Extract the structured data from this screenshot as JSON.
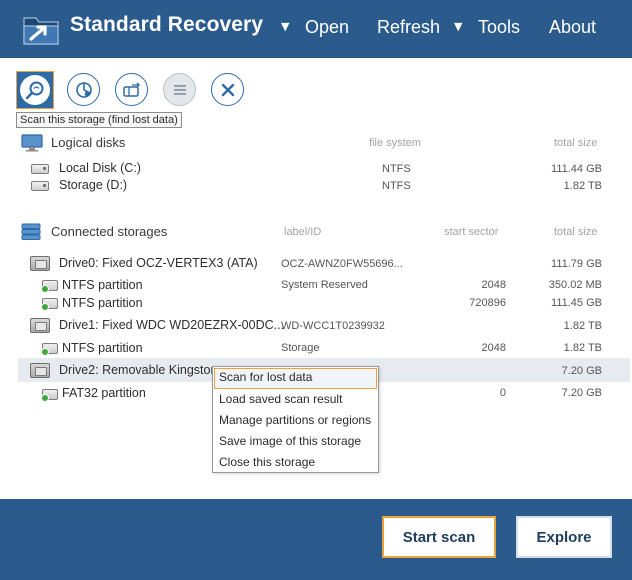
{
  "app": {
    "title": "Standard Recovery",
    "colors": {
      "header": "#2b5b8c",
      "accent": "#e8a33d",
      "icon_blue": "#2e6aa5",
      "partition_green": "#3ea83e"
    }
  },
  "menu": {
    "open": "Open",
    "refresh": "Refresh",
    "tools": "Tools",
    "about": "About",
    "caret": "▼"
  },
  "toolbar": {
    "icons": [
      "scan-storage-icon",
      "pie-chart-icon",
      "partitions-icon",
      "list-icon",
      "close-icon"
    ],
    "tooltip": "Scan this storage (find lost data)"
  },
  "logical_disks": {
    "title": "Logical disks",
    "col_fs": "file system",
    "col_size": "total size",
    "rows": [
      {
        "name": "Local Disk (C:)",
        "fs": "NTFS",
        "size": "111.44 GB"
      },
      {
        "name": "Storage (D:)",
        "fs": "NTFS",
        "size": "1.82 TB"
      }
    ]
  },
  "storages": {
    "title": "Connected storages",
    "col_label": "label/ID",
    "col_sector": "start sector",
    "col_size": "total size",
    "rows": [
      {
        "name": "Drive0: Fixed OCZ-VERTEX3 (ATA)",
        "label": "OCZ-AWNZ0FW55696...",
        "sector": "",
        "size": "111.79 GB"
      },
      {
        "name": "NTFS partition",
        "label": "System Reserved",
        "sector": "2048",
        "size": "350.02 MB"
      },
      {
        "name": "NTFS partition",
        "label": "",
        "sector": "720896",
        "size": "111.45 GB"
      },
      {
        "name": "Drive1: Fixed WDC WD20EZRX-00DC...",
        "label": "WD-WCC1T0239932",
        "sector": "",
        "size": "1.82 TB"
      },
      {
        "name": "NTFS partition",
        "label": "Storage",
        "sector": "2048",
        "size": "1.82 TB"
      },
      {
        "name": "Drive2: Removable Kingston",
        "label": "",
        "sector": "",
        "size": "7.20 GB"
      },
      {
        "name": "FAT32 partition",
        "label": "",
        "sector": "0",
        "size": "7.20 GB"
      }
    ]
  },
  "context_menu": {
    "items": [
      "Scan for lost data",
      "Load saved scan result",
      "Manage partitions or regions",
      "Save image of this storage",
      "Close this storage"
    ]
  },
  "footer": {
    "start_scan": "Start scan",
    "explore": "Explore"
  }
}
